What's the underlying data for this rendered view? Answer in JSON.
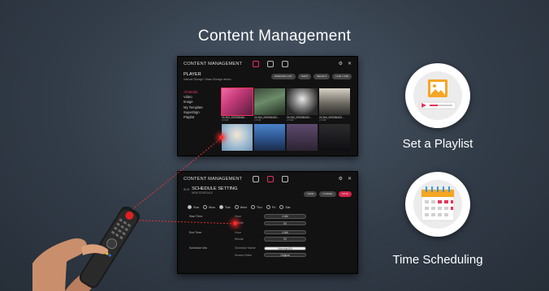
{
  "page": {
    "title": "Content Management"
  },
  "player_screen": {
    "app_title": "CONTENT MANAGEMENT",
    "section": "PLAYER",
    "path": "Internal Storage / Mass Storage device",
    "pills": [
      "OPERATE LIST",
      "SORT",
      "SELECT",
      "LIVE / USB"
    ],
    "sidebar": [
      "All Media",
      "Video",
      "Image",
      "My Template",
      "SuperSign",
      "Playlist"
    ],
    "thumbs": [
      {
        "caption": "24.264_0092284A6...",
        "sub": "2.8 MB"
      },
      {
        "caption": "24.264_0092344G2...",
        "sub": "2.8 MB"
      },
      {
        "caption": "24.264_0092364G2...",
        "sub": "2.8 MB"
      },
      {
        "caption": "24.264_0092364G2...",
        "sub": "2.8 MB"
      },
      {
        "caption": "",
        "sub": ""
      },
      {
        "caption": "",
        "sub": ""
      },
      {
        "caption": "",
        "sub": ""
      },
      {
        "caption": "",
        "sub": ""
      }
    ]
  },
  "schedule_screen": {
    "app_title": "CONTENT MANAGEMENT",
    "back": "SCH",
    "title": "SCHEDULE SETTING",
    "subtitle": "NEW SCHEDULE",
    "pills": [
      "SAVE",
      "CANCEL",
      "SAVE"
    ],
    "days": [
      "Sun",
      "Mon",
      "Tue",
      "Wed",
      "Thu",
      "Fri",
      "Sat"
    ],
    "rows": [
      {
        "label": "Start Time",
        "field": "Hour",
        "value": "4 AM"
      },
      {
        "label": "",
        "field": "Minute",
        "value": "00"
      },
      {
        "label": "End Time",
        "field": "Hour",
        "value": "4 AM"
      },
      {
        "label": "",
        "field": "Minute",
        "value": "00"
      },
      {
        "label": "Schedule Info",
        "field": "Schedule Name",
        "value": "Schedule001"
      },
      {
        "label": "",
        "field": "Screen Ratio",
        "value": "Original"
      }
    ]
  },
  "features": [
    {
      "label": "Set a Playlist",
      "icon": "playlist-icon"
    },
    {
      "label": "Time Scheduling",
      "icon": "calendar-icon"
    }
  ],
  "colors": {
    "accent": "#e6325a",
    "background": "#323c48"
  }
}
